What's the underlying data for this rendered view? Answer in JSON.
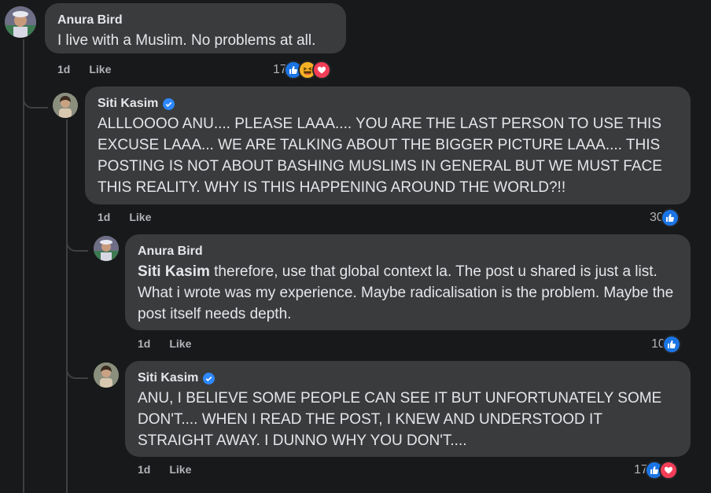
{
  "colors": {
    "like": "#1b74e4",
    "love": "#f33e58",
    "haha": "#f7b125",
    "verified": "#2d88ff"
  },
  "comments": [
    {
      "author": "Anura Bird",
      "text": "I live with a Muslim. No problems at all.",
      "time": "1d",
      "like_label": "Like",
      "reaction_count": "17",
      "reactions": [
        "like-icon",
        "haha-icon",
        "love-icon"
      ]
    },
    {
      "author": "Siti Kasim",
      "verified": true,
      "text": "ALLLOOOO ANU.... PLEASE LAAA.... YOU ARE THE LAST PERSON TO USE THIS EXCUSE LAAA... WE ARE TALKING ABOUT THE BIGGER PICTURE LAAA.... THIS POSTING IS NOT ABOUT BASHING MUSLIMS IN GENERAL BUT WE MUST FACE THIS REALITY. WHY IS THIS HAPPENING AROUND THE WORLD?!!",
      "time": "1d",
      "like_label": "Like",
      "reaction_count": "30",
      "reactions": [
        "like-icon"
      ]
    },
    {
      "author": "Anura Bird",
      "mention": "Siti Kasim",
      "text": " therefore, use that global context la. The post u shared is just a list. What i wrote was my experience. Maybe radicalisation is the problem. Maybe the post itself needs depth.",
      "time": "1d",
      "like_label": "Like",
      "reaction_count": "10",
      "reactions": [
        "like-icon"
      ]
    },
    {
      "author": "Siti Kasim",
      "verified": true,
      "text": "ANU, I BELIEVE SOME PEOPLE CAN SEE IT BUT UNFORTUNATELY SOME DON'T.... WHEN I READ THE POST, I KNEW AND UNDERSTOOD IT STRAIGHT AWAY. I DUNNO WHY YOU DON'T....",
      "time": "1d",
      "like_label": "Like",
      "reaction_count": "17",
      "reactions": [
        "like-icon",
        "love-icon"
      ]
    }
  ]
}
